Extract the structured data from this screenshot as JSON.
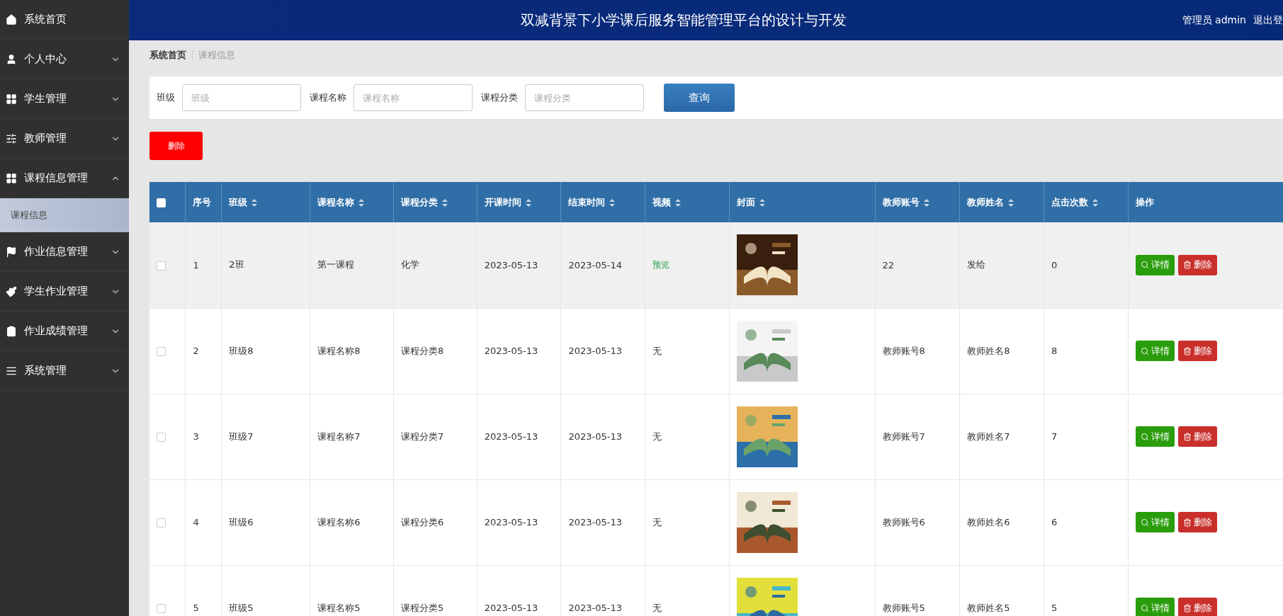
{
  "header": {
    "title": "双减背景下小学课后服务智能管理平台的设计与开发",
    "user": "管理员 admin",
    "logout": "退出登"
  },
  "sidebar": {
    "items": [
      {
        "label": "系统首页",
        "has_caret": false
      },
      {
        "label": "个人中心",
        "expanded": false,
        "has_caret": true
      },
      {
        "label": "学生管理",
        "expanded": false,
        "has_caret": true
      },
      {
        "label": "教师管理",
        "expanded": false,
        "has_caret": true
      },
      {
        "label": "课程信息管理",
        "expanded": true,
        "has_caret": true,
        "children": [
          {
            "label": "课程信息",
            "selected": true
          }
        ]
      },
      {
        "label": "作业信息管理",
        "expanded": false,
        "has_caret": true
      },
      {
        "label": "学生作业管理",
        "expanded": false,
        "has_caret": true
      },
      {
        "label": "作业成绩管理",
        "expanded": false,
        "has_caret": true
      },
      {
        "label": "系统管理",
        "expanded": false,
        "has_caret": true
      }
    ]
  },
  "breadcrumb": [
    "系统首页",
    "课程信息"
  ],
  "search": {
    "fields": [
      {
        "label": "班级",
        "placeholder": "班级"
      },
      {
        "label": "课程名称",
        "placeholder": "课程名称"
      },
      {
        "label": "课程分类",
        "placeholder": "课程分类"
      }
    ],
    "button": "查询"
  },
  "delete_button": "删除",
  "table": {
    "select_all_checked": false,
    "columns": [
      {
        "label": "序号",
        "sortable": false
      },
      {
        "label": "班级",
        "sortable": true
      },
      {
        "label": "课程名称",
        "sortable": true
      },
      {
        "label": "课程分类",
        "sortable": true
      },
      {
        "label": "开课时间",
        "sortable": true
      },
      {
        "label": "结束时间",
        "sortable": true
      },
      {
        "label": "视频",
        "sortable": true
      },
      {
        "label": "封面",
        "sortable": true
      },
      {
        "label": "教师账号",
        "sortable": true
      },
      {
        "label": "教师姓名",
        "sortable": true
      },
      {
        "label": "点击次数",
        "sortable": true
      },
      {
        "label": "操作",
        "sortable": false
      }
    ],
    "rows": [
      {
        "checked": false,
        "highlighted": true,
        "no": "1",
        "class": "2班",
        "name": "第一课程",
        "category": "化学",
        "start": "2023-05-13",
        "end": "2023-05-14",
        "video": "预览",
        "video_link": true,
        "teacher_account": "22",
        "teacher_name": "发给",
        "clicks": "0",
        "detail": "详情",
        "delete": "删除"
      },
      {
        "checked": false,
        "highlighted": false,
        "no": "2",
        "class": "班级8",
        "name": "课程名称8",
        "category": "课程分类8",
        "start": "2023-05-13",
        "end": "2023-05-13",
        "video": "无",
        "video_link": false,
        "teacher_account": "教师账号8",
        "teacher_name": "教师姓名8",
        "clicks": "8",
        "detail": "详情",
        "delete": "删除"
      },
      {
        "checked": false,
        "highlighted": false,
        "no": "3",
        "class": "班级7",
        "name": "课程名称7",
        "category": "课程分类7",
        "start": "2023-05-13",
        "end": "2023-05-13",
        "video": "无",
        "video_link": false,
        "teacher_account": "教师账号7",
        "teacher_name": "教师姓名7",
        "clicks": "7",
        "detail": "详情",
        "delete": "删除"
      },
      {
        "checked": false,
        "highlighted": false,
        "no": "4",
        "class": "班级6",
        "name": "课程名称6",
        "category": "课程分类6",
        "start": "2023-05-13",
        "end": "2023-05-13",
        "video": "无",
        "video_link": false,
        "teacher_account": "教师账号6",
        "teacher_name": "教师姓名6",
        "clicks": "6",
        "detail": "详情",
        "delete": "删除"
      },
      {
        "checked": false,
        "highlighted": false,
        "no": "5",
        "class": "班级5",
        "name": "课程名称5",
        "category": "课程分类5",
        "start": "2023-05-13",
        "end": "2023-05-13",
        "video": "无",
        "video_link": false,
        "teacher_account": "教师账号5",
        "teacher_name": "教师姓名5",
        "clicks": "5",
        "detail": "详情",
        "delete": "删除"
      }
    ]
  }
}
